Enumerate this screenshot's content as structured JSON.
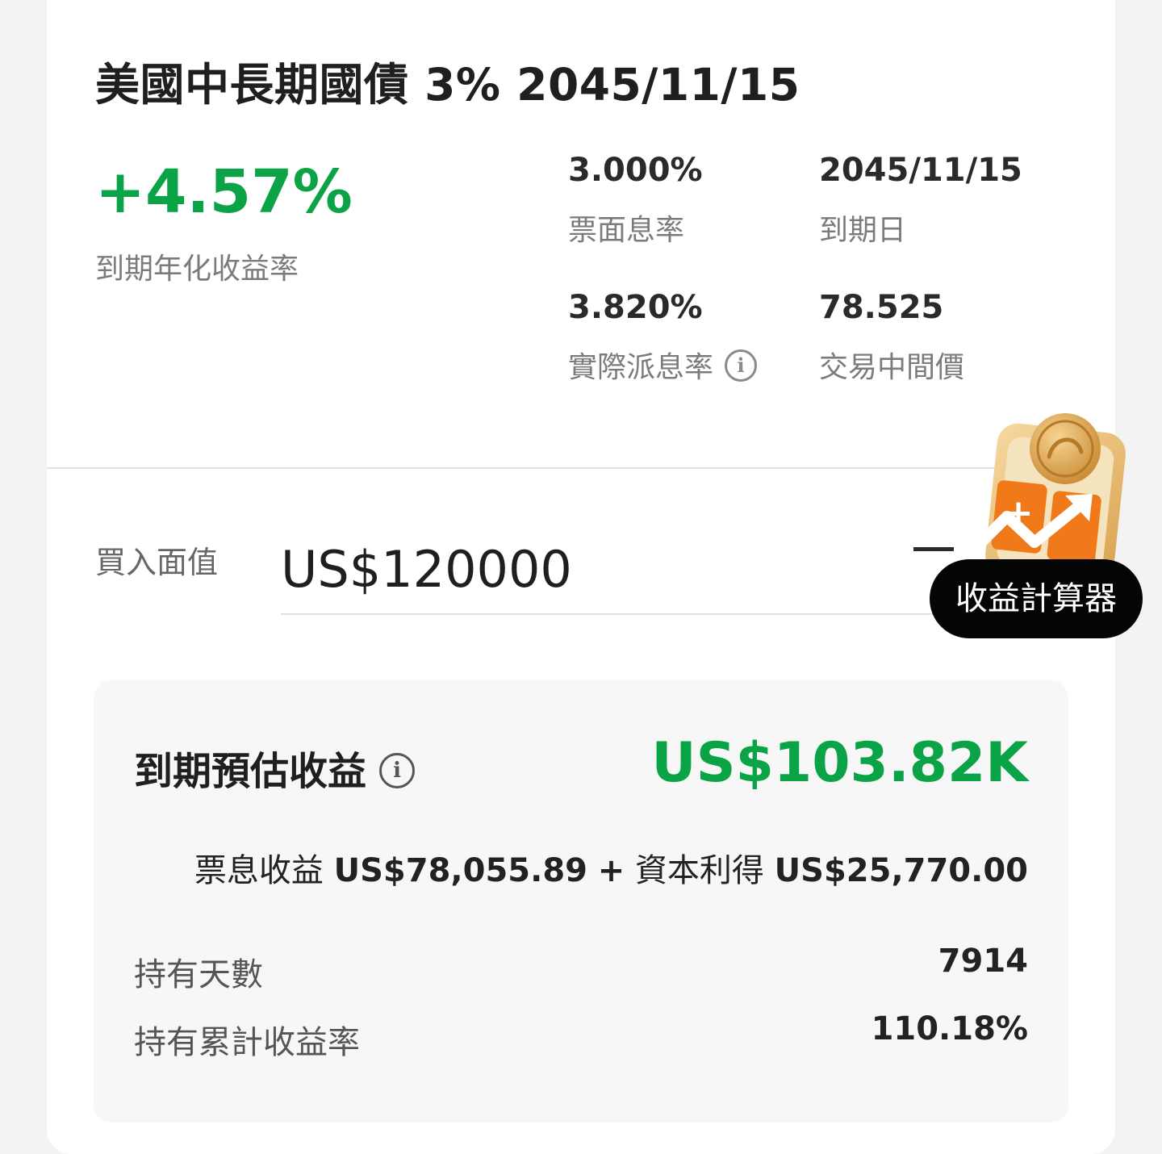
{
  "bond": {
    "title": "美國中長期國債 3% 2045/11/15"
  },
  "ytm": {
    "value": "+4.57%",
    "label": "到期年化收益率"
  },
  "stats": {
    "coupon_rate": {
      "value": "3.000%",
      "label": "票面息率"
    },
    "maturity_date": {
      "value": "2045/11/15",
      "label": "到期日"
    },
    "current_yield": {
      "value": "3.820%",
      "label": "實際派息率"
    },
    "mid_price": {
      "value": "78.525",
      "label": "交易中間價"
    }
  },
  "purchase": {
    "face_value_label": "買入面值",
    "face_value": "US$120000"
  },
  "calculator": {
    "label": "收益計算器"
  },
  "estimate": {
    "title": "到期預估收益",
    "total": "US$103.82K",
    "coupon_income_label": "票息收益",
    "coupon_income": "US$78,055.89",
    "plus": "+",
    "capital_gain_label": "資本利得",
    "capital_gain": "US$25,770.00",
    "holding_days_label": "持有天數",
    "holding_days": "7914",
    "cumulative_return_label": "持有累計收益率",
    "cumulative_return": "110.18%"
  },
  "colors": {
    "positive": "#0aa447",
    "card": "#ffffff",
    "page_background": "#f3f3f3",
    "panel_background": "#f7f7f7",
    "calculator_button": "#050505",
    "calculator_orange": "#f07a1a",
    "coin_gold": "#e2a64a"
  },
  "icons": {
    "info": "info-icon",
    "calculator": "calculator-coin-icon"
  }
}
